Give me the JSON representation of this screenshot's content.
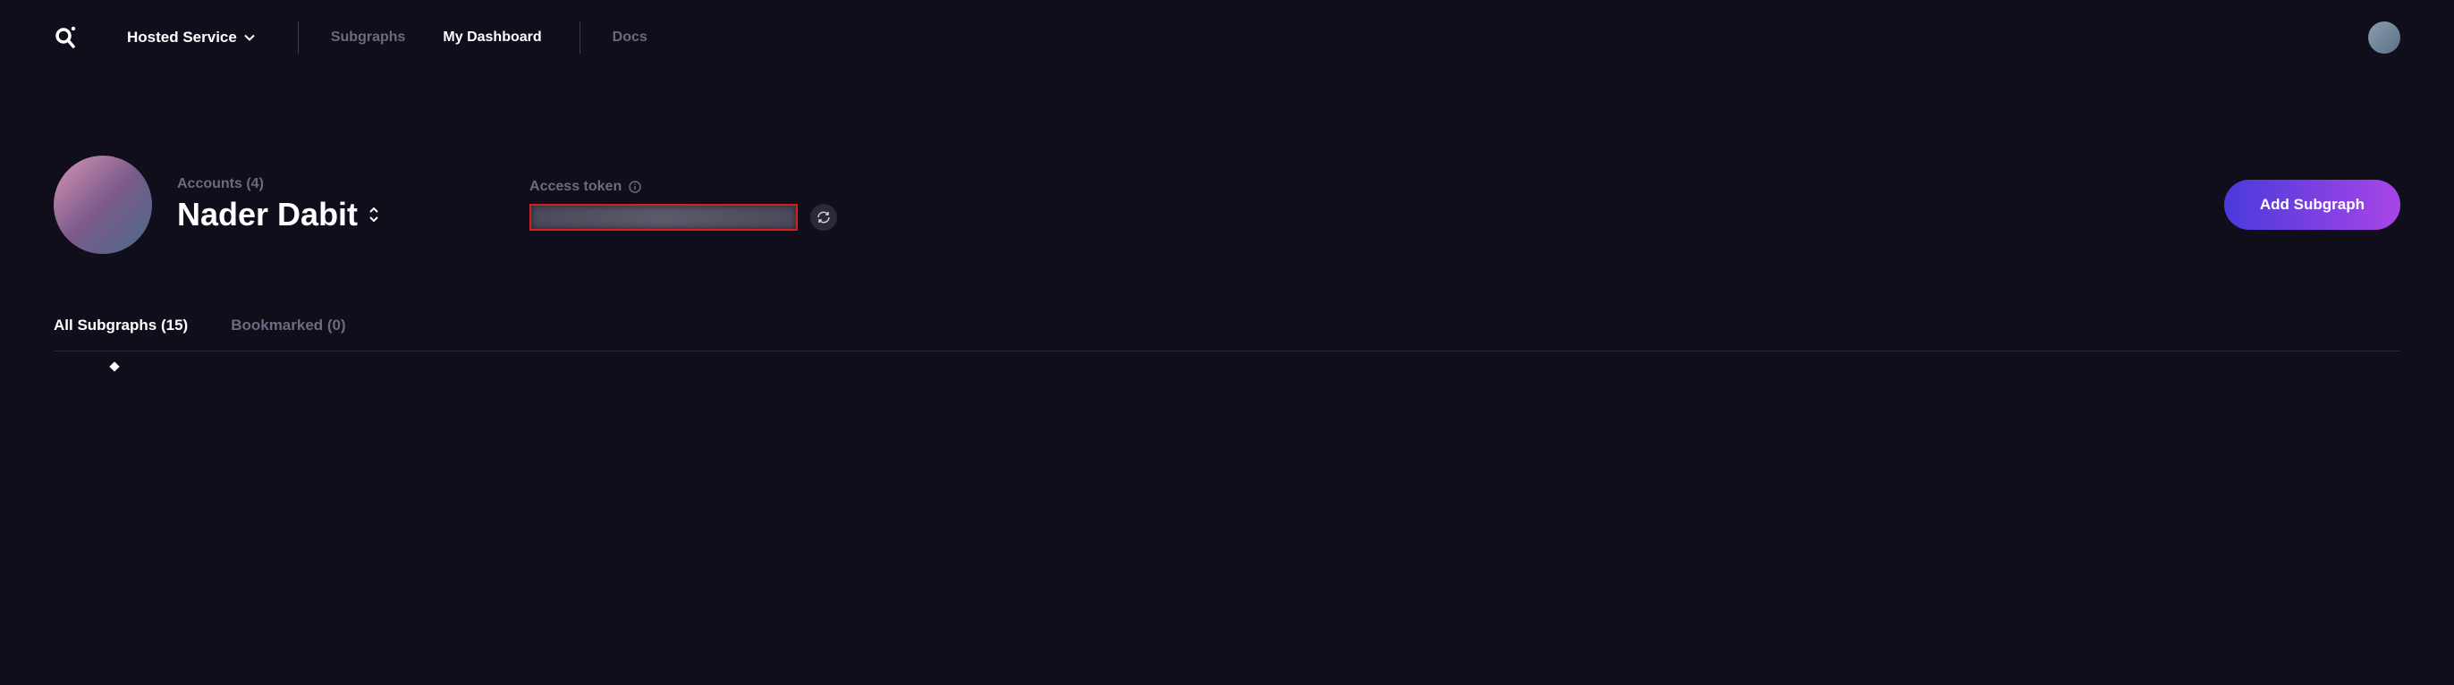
{
  "header": {
    "service_label": "Hosted Service",
    "nav": {
      "subgraphs": "Subgraphs",
      "dashboard": "My Dashboard",
      "docs": "Docs"
    }
  },
  "profile": {
    "accounts_label": "Accounts (4)",
    "user_name": "Nader Dabit"
  },
  "token": {
    "label": "Access token"
  },
  "actions": {
    "add_subgraph": "Add Subgraph"
  },
  "tabs": {
    "all": "All Subgraphs (15)",
    "bookmarked": "Bookmarked (0)"
  }
}
